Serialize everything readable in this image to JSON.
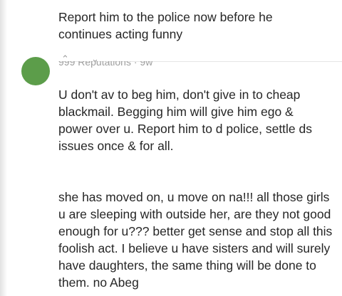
{
  "comments": [
    {
      "lines": [
        "Report him to the police now before he",
        "continues acting funny"
      ]
    },
    {
      "author_line": "999 Reputations · 9w",
      "lines": [
        "U don't av to beg him, don't give in to cheap",
        "blackmail. Begging him will give him ego &",
        "power over u. Report him to d police, settle ds",
        "issues once & for all."
      ]
    },
    {
      "lines": [
        "she has moved on, u move on na!!! all those girls",
        "u are sleeping with outside her, are they not good",
        "enough for u??? better get sense and stop all this",
        "foolish act. I believe u have sisters and will surely",
        "have daughters, the same thing will be done to",
        "them. no Abeg"
      ]
    }
  ],
  "icons": {
    "upvote": "arrow-up-icon",
    "downvote": "arrow-down-icon"
  },
  "colors": {
    "avatar": "#5c9d4a",
    "text": "#262626",
    "meta": "#9e9e9e"
  }
}
